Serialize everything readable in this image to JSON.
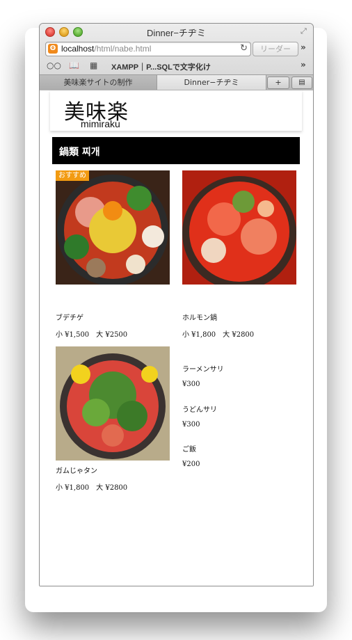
{
  "window": {
    "title": "Dinner−チヂミ"
  },
  "toolbar": {
    "url_host": "localhost",
    "url_path": "/html/nabe.html",
    "reader_label": "リーダー",
    "bookmark_label": "XAMPP｜P...SQLで文字化け"
  },
  "tabs": [
    {
      "label": "美味楽サイトの制作"
    },
    {
      "label": "Dinner−チヂミ"
    }
  ],
  "site": {
    "logo_main": "美味楽",
    "logo_sub": "mimiraku"
  },
  "category": {
    "title": "鍋類 찌개"
  },
  "dishes": [
    {
      "name": "ブデチゲ",
      "price": "小 ¥1,500　大 ¥2500",
      "badge": "おすすめ"
    },
    {
      "name": "ホルモン鍋",
      "price": "小 ¥1,800　大 ¥2800"
    },
    {
      "name": "ガムじゃタン",
      "price": "小 ¥1,800　大 ¥2800"
    }
  ],
  "sides": [
    {
      "name": "ラーメンサリ",
      "price": "¥300"
    },
    {
      "name": "うどんサリ",
      "price": "¥300"
    },
    {
      "name": "ご飯",
      "price": "¥200"
    }
  ],
  "colors": {
    "badge": "#f29b12",
    "category_bg": "#000000"
  }
}
